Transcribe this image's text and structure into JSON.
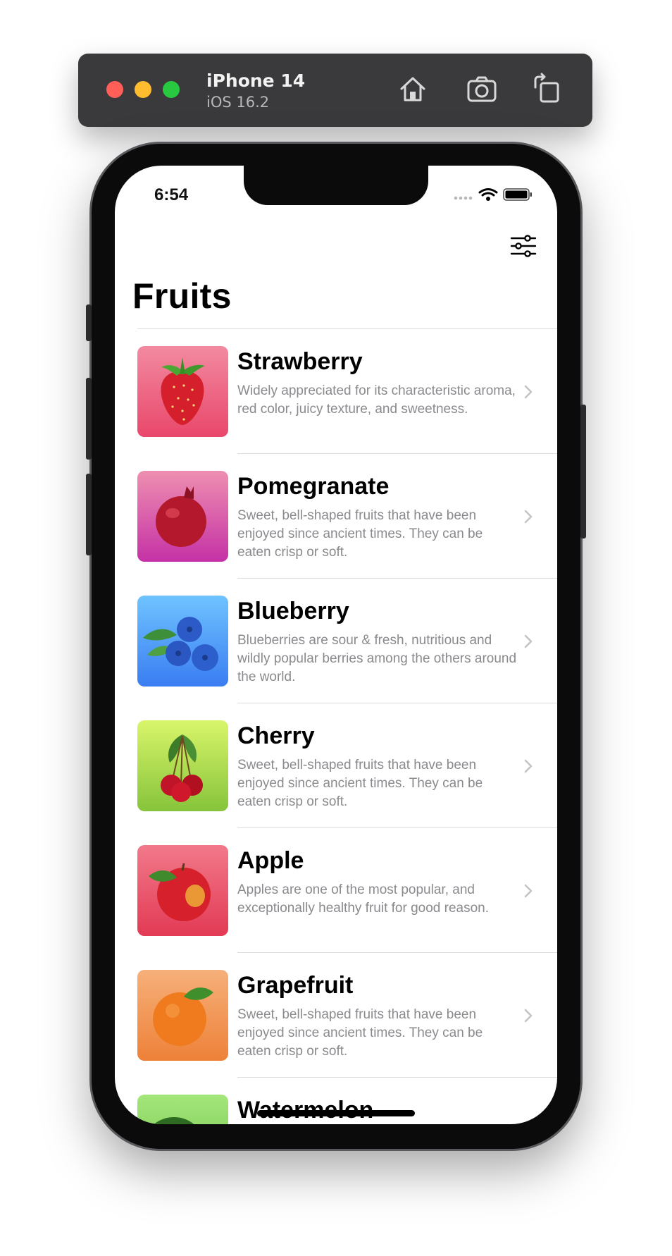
{
  "simulator": {
    "device_name": "iPhone 14",
    "os_version": "iOS 16.2",
    "buttons": [
      "home-icon",
      "screenshot-icon",
      "rotate-icon"
    ]
  },
  "status_bar": {
    "time": "6:54"
  },
  "nav": {
    "title": "Fruits",
    "filter_icon": "sliders-icon"
  },
  "fruits": [
    {
      "name": "Strawberry",
      "description": "Widely appreciated for its characteristic aroma,  red color, juicy texture, and sweetness.",
      "gradient": [
        "#f28aa0",
        "#e9476b"
      ]
    },
    {
      "name": "Pomegranate",
      "description": "Sweet, bell-shaped fruits that have been enjoyed since ancient times. They can be eaten crisp or soft.",
      "gradient": [
        "#ee8fb0",
        "#c531a6"
      ]
    },
    {
      "name": "Blueberry",
      "description": "Blueberries are sour & fresh, nutritious and wildly popular berries among the others around the world.",
      "gradient": [
        "#6fc3ff",
        "#3a7df2"
      ]
    },
    {
      "name": "Cherry",
      "description": "Sweet, bell-shaped fruits that have been enjoyed since ancient times. They can be eaten crisp or soft.",
      "gradient": [
        "#d9f56a",
        "#86c43b"
      ]
    },
    {
      "name": "Apple",
      "description": "Apples are one of the most popular, and exceptionally healthy fruit for good reason.",
      "gradient": [
        "#f2798a",
        "#e23a55"
      ]
    },
    {
      "name": "Grapefruit",
      "description": "Sweet, bell-shaped fruits that have been enjoyed since ancient times. They can be eaten crisp or soft.",
      "gradient": [
        "#f6b07a",
        "#ee8138"
      ]
    },
    {
      "name": "Watermelon",
      "description": "",
      "gradient": [
        "#a4e67a",
        "#6cc24b"
      ]
    }
  ]
}
